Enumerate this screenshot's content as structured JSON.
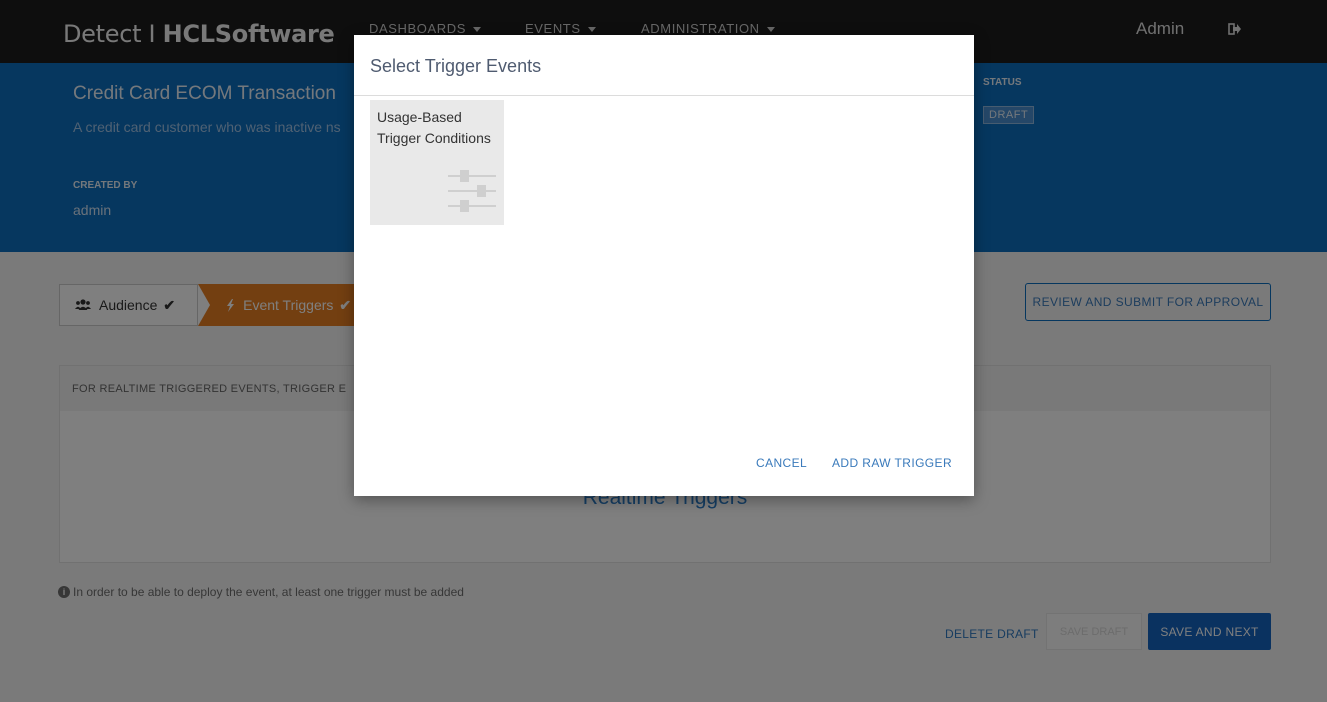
{
  "header": {
    "brand_light": "Detect I ",
    "brand_bold": "HCLSoftware",
    "nav": [
      "DASHBOARDS",
      "EVENTS",
      "ADMINISTRATION"
    ],
    "user": "Admin",
    "logout_icon": "sign-out-icon"
  },
  "event": {
    "title": "Credit Card ECOM Transaction",
    "description": "A credit card customer who was inactive ns",
    "created_by_label": "CREATED BY",
    "created_by_value": "admin",
    "status_label": "STATUS",
    "status_value": "DRAFT"
  },
  "stepper": {
    "steps": [
      {
        "label": "Audience",
        "icon": "users-icon",
        "done": true
      },
      {
        "label": "Event Triggers",
        "icon": "bolt-icon",
        "done": true
      }
    ]
  },
  "actions": {
    "review": "REVIEW AND SUBMIT FOR APPROVAL",
    "delete_draft": "DELETE DRAFT",
    "save_draft": "SAVE DRAFT",
    "save_next": "SAVE AND NEXT"
  },
  "panel": {
    "header": "FOR REALTIME TRIGGERED EVENTS, TRIGGER E",
    "big_label": "Realtime Triggers"
  },
  "note": "In order to be able to deploy the event, at least one trigger must be added",
  "modal": {
    "title": "Select Trigger Events",
    "tiles": [
      {
        "label": "Usage-Based Trigger Conditions",
        "icon": "sliders-icon"
      }
    ],
    "cancel": "CANCEL",
    "add_raw": "ADD RAW TRIGGER"
  },
  "colors": {
    "topbar": "#1c1c1c",
    "hero": "#0d6ebf",
    "step_active": "#e67e22",
    "primary": "#1565c0",
    "link": "#3a7abb"
  }
}
